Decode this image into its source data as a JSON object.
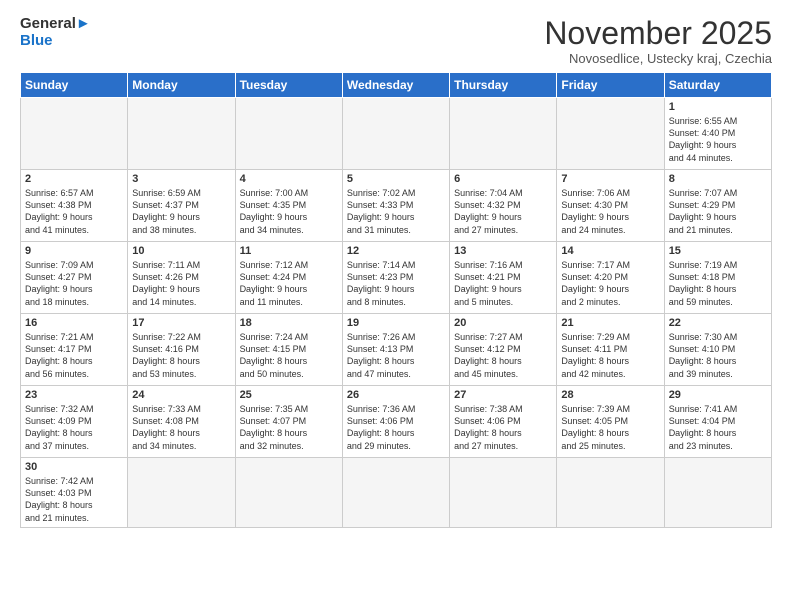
{
  "header": {
    "logo_general": "General",
    "logo_blue": "Blue",
    "month_title": "November 2025",
    "subtitle": "Novosedlice, Ustecky kraj, Czechia"
  },
  "days_of_week": [
    "Sunday",
    "Monday",
    "Tuesday",
    "Wednesday",
    "Thursday",
    "Friday",
    "Saturday"
  ],
  "weeks": [
    [
      {
        "day": "",
        "info": "",
        "empty": true
      },
      {
        "day": "",
        "info": "",
        "empty": true
      },
      {
        "day": "",
        "info": "",
        "empty": true
      },
      {
        "day": "",
        "info": "",
        "empty": true
      },
      {
        "day": "",
        "info": "",
        "empty": true
      },
      {
        "day": "",
        "info": "",
        "empty": true
      },
      {
        "day": "1",
        "info": "Sunrise: 6:55 AM\nSunset: 4:40 PM\nDaylight: 9 hours\nand 44 minutes."
      }
    ],
    [
      {
        "day": "2",
        "info": "Sunrise: 6:57 AM\nSunset: 4:38 PM\nDaylight: 9 hours\nand 41 minutes."
      },
      {
        "day": "3",
        "info": "Sunrise: 6:59 AM\nSunset: 4:37 PM\nDaylight: 9 hours\nand 38 minutes."
      },
      {
        "day": "4",
        "info": "Sunrise: 7:00 AM\nSunset: 4:35 PM\nDaylight: 9 hours\nand 34 minutes."
      },
      {
        "day": "5",
        "info": "Sunrise: 7:02 AM\nSunset: 4:33 PM\nDaylight: 9 hours\nand 31 minutes."
      },
      {
        "day": "6",
        "info": "Sunrise: 7:04 AM\nSunset: 4:32 PM\nDaylight: 9 hours\nand 27 minutes."
      },
      {
        "day": "7",
        "info": "Sunrise: 7:06 AM\nSunset: 4:30 PM\nDaylight: 9 hours\nand 24 minutes."
      },
      {
        "day": "8",
        "info": "Sunrise: 7:07 AM\nSunset: 4:29 PM\nDaylight: 9 hours\nand 21 minutes."
      }
    ],
    [
      {
        "day": "9",
        "info": "Sunrise: 7:09 AM\nSunset: 4:27 PM\nDaylight: 9 hours\nand 18 minutes."
      },
      {
        "day": "10",
        "info": "Sunrise: 7:11 AM\nSunset: 4:26 PM\nDaylight: 9 hours\nand 14 minutes."
      },
      {
        "day": "11",
        "info": "Sunrise: 7:12 AM\nSunset: 4:24 PM\nDaylight: 9 hours\nand 11 minutes."
      },
      {
        "day": "12",
        "info": "Sunrise: 7:14 AM\nSunset: 4:23 PM\nDaylight: 9 hours\nand 8 minutes."
      },
      {
        "day": "13",
        "info": "Sunrise: 7:16 AM\nSunset: 4:21 PM\nDaylight: 9 hours\nand 5 minutes."
      },
      {
        "day": "14",
        "info": "Sunrise: 7:17 AM\nSunset: 4:20 PM\nDaylight: 9 hours\nand 2 minutes."
      },
      {
        "day": "15",
        "info": "Sunrise: 7:19 AM\nSunset: 4:18 PM\nDaylight: 8 hours\nand 59 minutes."
      }
    ],
    [
      {
        "day": "16",
        "info": "Sunrise: 7:21 AM\nSunset: 4:17 PM\nDaylight: 8 hours\nand 56 minutes."
      },
      {
        "day": "17",
        "info": "Sunrise: 7:22 AM\nSunset: 4:16 PM\nDaylight: 8 hours\nand 53 minutes."
      },
      {
        "day": "18",
        "info": "Sunrise: 7:24 AM\nSunset: 4:15 PM\nDaylight: 8 hours\nand 50 minutes."
      },
      {
        "day": "19",
        "info": "Sunrise: 7:26 AM\nSunset: 4:13 PM\nDaylight: 8 hours\nand 47 minutes."
      },
      {
        "day": "20",
        "info": "Sunrise: 7:27 AM\nSunset: 4:12 PM\nDaylight: 8 hours\nand 45 minutes."
      },
      {
        "day": "21",
        "info": "Sunrise: 7:29 AM\nSunset: 4:11 PM\nDaylight: 8 hours\nand 42 minutes."
      },
      {
        "day": "22",
        "info": "Sunrise: 7:30 AM\nSunset: 4:10 PM\nDaylight: 8 hours\nand 39 minutes."
      }
    ],
    [
      {
        "day": "23",
        "info": "Sunrise: 7:32 AM\nSunset: 4:09 PM\nDaylight: 8 hours\nand 37 minutes."
      },
      {
        "day": "24",
        "info": "Sunrise: 7:33 AM\nSunset: 4:08 PM\nDaylight: 8 hours\nand 34 minutes."
      },
      {
        "day": "25",
        "info": "Sunrise: 7:35 AM\nSunset: 4:07 PM\nDaylight: 8 hours\nand 32 minutes."
      },
      {
        "day": "26",
        "info": "Sunrise: 7:36 AM\nSunset: 4:06 PM\nDaylight: 8 hours\nand 29 minutes."
      },
      {
        "day": "27",
        "info": "Sunrise: 7:38 AM\nSunset: 4:06 PM\nDaylight: 8 hours\nand 27 minutes."
      },
      {
        "day": "28",
        "info": "Sunrise: 7:39 AM\nSunset: 4:05 PM\nDaylight: 8 hours\nand 25 minutes."
      },
      {
        "day": "29",
        "info": "Sunrise: 7:41 AM\nSunset: 4:04 PM\nDaylight: 8 hours\nand 23 minutes."
      }
    ],
    [
      {
        "day": "30",
        "info": "Sunrise: 7:42 AM\nSunset: 4:03 PM\nDaylight: 8 hours\nand 21 minutes.",
        "last": true
      },
      {
        "day": "",
        "info": "",
        "empty": true,
        "last": true
      },
      {
        "day": "",
        "info": "",
        "empty": true,
        "last": true
      },
      {
        "day": "",
        "info": "",
        "empty": true,
        "last": true
      },
      {
        "day": "",
        "info": "",
        "empty": true,
        "last": true
      },
      {
        "day": "",
        "info": "",
        "empty": true,
        "last": true
      },
      {
        "day": "",
        "info": "",
        "empty": true,
        "last": true
      }
    ]
  ]
}
